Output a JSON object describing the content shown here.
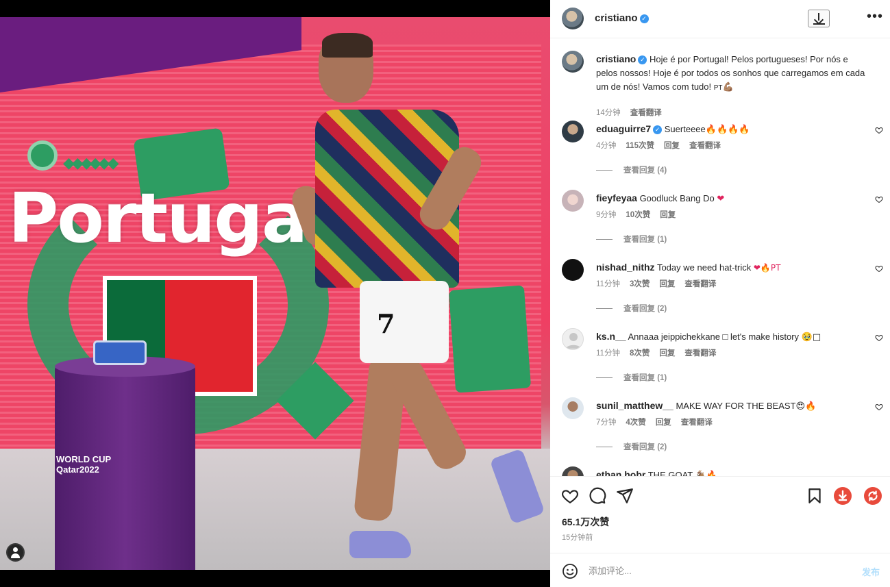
{
  "post": {
    "username": "cristiano",
    "verified": true,
    "caption": "Hoje é por Portugal! Pelos portugueses! Por nós e pelos nossos! Hoje é por todos os sonhos que carregamos em cada um de nós! Vamos com tudo! ",
    "caption_flag": "PT",
    "caption_emoji": "💪🏽",
    "caption_time": "14分钟",
    "caption_translate": "查看翻译",
    "photo_text": "Portugal",
    "photo_badge": "WORLD CUP\nQatar2022",
    "photo_number": "7"
  },
  "comments": [
    {
      "user": "eduaguirre7",
      "verified": true,
      "text": "Suerteeee",
      "emoji": "🔥🔥🔥🔥",
      "time": "4分钟",
      "likes": "115次赞",
      "reply": "回复",
      "translate": "查看翻译",
      "view_replies": "查看回复 (4)"
    },
    {
      "user": "fieyfeyaa",
      "verified": false,
      "text": "Goodluck Bang Do",
      "emoji": "❤",
      "time": "9分钟",
      "likes": "10次赞",
      "reply": "回复",
      "translate": "",
      "view_replies": "查看回复 (1)"
    },
    {
      "user": "nishad_nithz",
      "verified": false,
      "text": "Today we need hat-trick",
      "emoji": "❤🔥PT",
      "time": "11分钟",
      "likes": "3次赞",
      "reply": "回复",
      "translate": "查看翻译",
      "view_replies": "查看回复 (2)"
    },
    {
      "user": "ks.n__",
      "verified": false,
      "text": "Annaaa jeippichekkane □ let's make history",
      "emoji": "🥹□",
      "time": "11分钟",
      "likes": "8次赞",
      "reply": "回复",
      "translate": "查看翻译",
      "view_replies": "查看回复 (1)"
    },
    {
      "user": "sunil_matthew__",
      "verified": false,
      "text": "MAKE WAY FOR THE BEAST",
      "emoji": "😍🔥",
      "time": "7分钟",
      "likes": "4次赞",
      "reply": "回复",
      "translate": "查看翻译",
      "view_replies": "查看回复 (2)"
    },
    {
      "user": "ethan.hobr",
      "verified": false,
      "text": "THE GOAT",
      "emoji": "🐐🔥",
      "time": "",
      "likes": "",
      "reply": "",
      "translate": "",
      "view_replies": ""
    }
  ],
  "actions": {
    "likes": "65.1万次赞",
    "time": "15分钟前",
    "icons": [
      "heart-icon",
      "comment-icon",
      "share-icon",
      "bookmark-icon",
      "download-ext-icon",
      "refresh-ext-icon"
    ],
    "ext_colors": {
      "download": "#e84a3b",
      "refresh": "#e84a3b"
    }
  },
  "comment_box": {
    "placeholder": "添加评论...",
    "post_label": "发布"
  },
  "colors": {
    "verified": "#3897f0",
    "text": "#262626",
    "muted": "#8e8e8e",
    "post_disabled": "#b2dffc"
  }
}
